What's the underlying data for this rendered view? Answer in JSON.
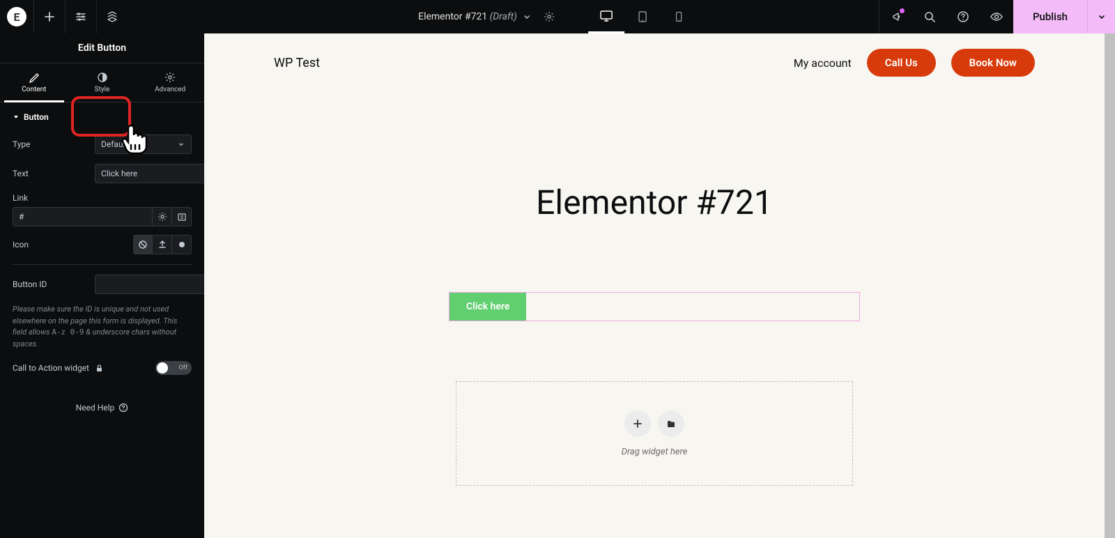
{
  "topbar": {
    "doc_title": "Elementor #721",
    "doc_status": "(Draft)",
    "publish": "Publish"
  },
  "sidebar": {
    "edit_title": "Edit Button",
    "tabs": {
      "content": "Content",
      "style": "Style",
      "advanced": "Advanced"
    },
    "section": "Button",
    "labels": {
      "type": "Type",
      "text": "Text",
      "link": "Link",
      "icon": "Icon",
      "button_id": "Button ID",
      "cta": "Call to Action widget",
      "need_help": "Need Help"
    },
    "values": {
      "type": "Default",
      "text": "Click here",
      "link": "#",
      "button_id": "",
      "toggle": "Off"
    },
    "help_text_pre": "Please make sure the ID is unique and not used elsewhere on the page this form is displayed. This field allows ",
    "help_text_code": "A-z 0-9",
    "help_text_post": " & underscore chars without spaces."
  },
  "canvas": {
    "site_name": "WP Test",
    "nav": {
      "account": "My account",
      "call": "Call Us",
      "book": "Book Now"
    },
    "hero": "Elementor #721",
    "button_text": "Click here",
    "drop_text": "Drag widget here"
  }
}
